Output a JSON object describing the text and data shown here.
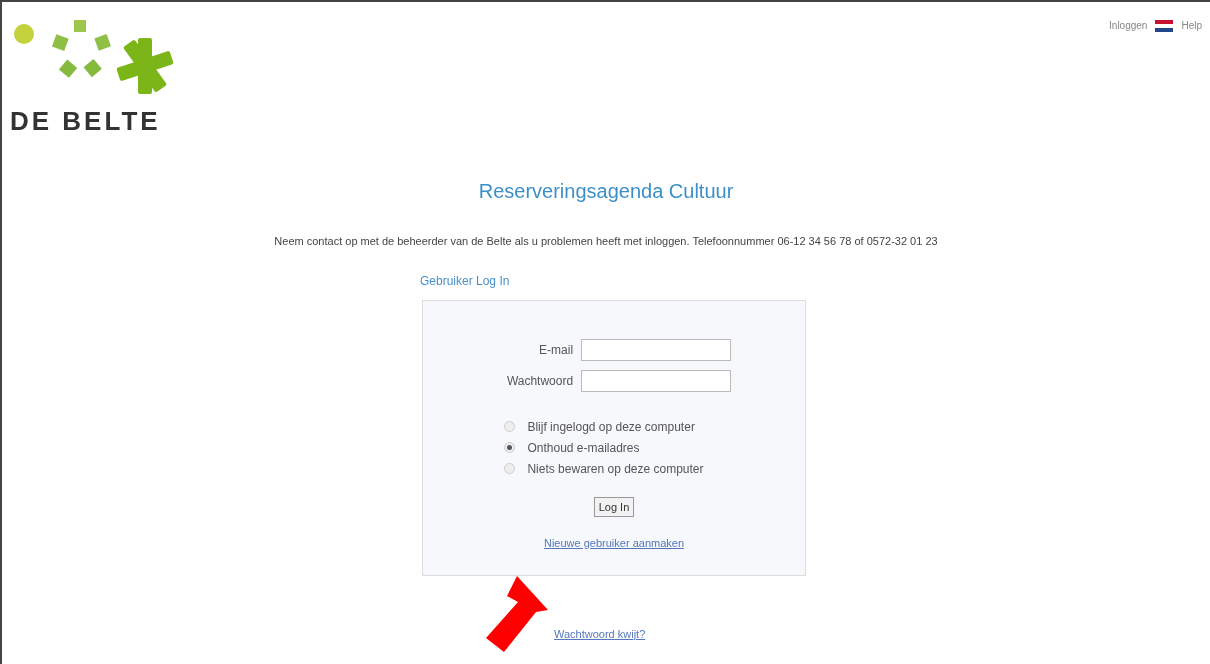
{
  "logo": {
    "text": "DE BELTE"
  },
  "top_links": {
    "login": "Inloggen",
    "help": "Help"
  },
  "title": "Reserveringsagenda Cultuur",
  "info": "Neem contact op met de beheerder van de Belte als u problemen heeft met inloggen. Telefoonnummer 06-12 34 56 78 of 0572-32 01 23",
  "login_heading": "Gebruiker Log In",
  "form": {
    "fields": [
      {
        "label": "E-mail"
      },
      {
        "label": "Wachtwoord"
      }
    ],
    "options": [
      {
        "label": "Blijf ingelogd op deze computer",
        "selected": false
      },
      {
        "label": "Onthoud e-mailadres",
        "selected": true
      },
      {
        "label": "Niets bewaren op deze computer",
        "selected": false
      }
    ],
    "submit": "Log In",
    "register_link": "Nieuwe gebruiker aanmaken"
  },
  "forgot_link": "Wachtwoord kwijt?"
}
